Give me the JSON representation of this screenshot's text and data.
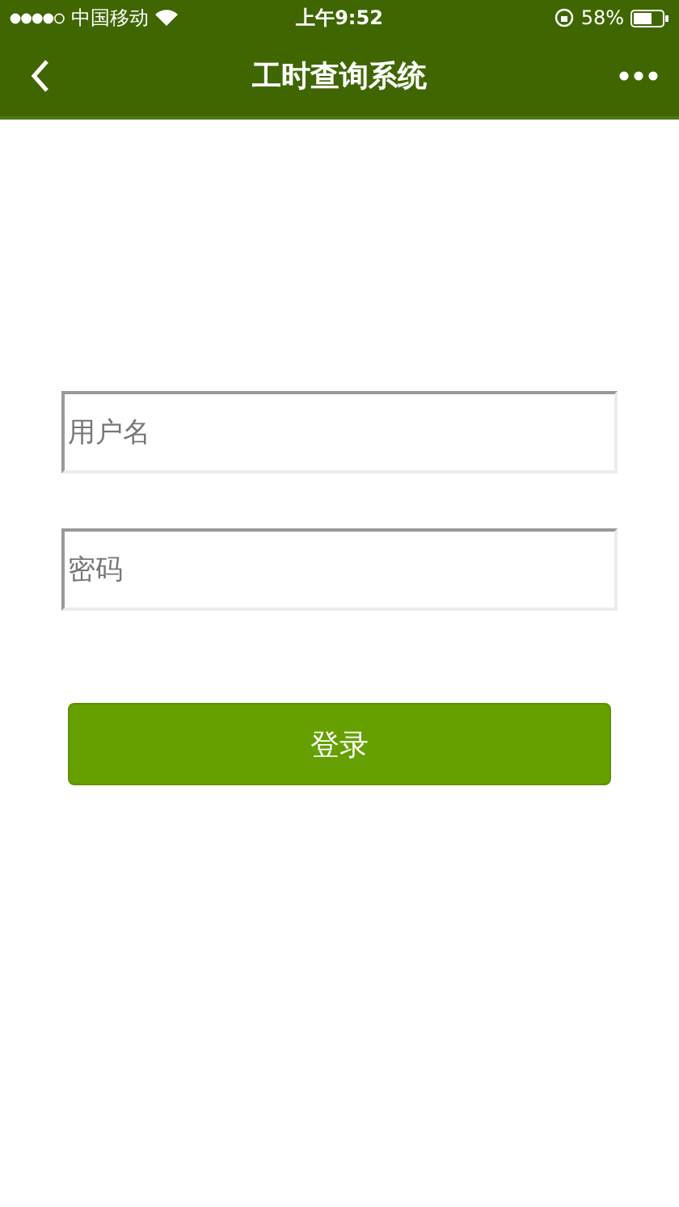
{
  "status_bar": {
    "carrier": "中国移动",
    "time": "上午9:52",
    "battery": "58%"
  },
  "nav_bar": {
    "title": "工时查询系统"
  },
  "form": {
    "fields": [
      {
        "placeholder": "用户名"
      },
      {
        "placeholder": "密码"
      }
    ],
    "submit": "登录"
  }
}
